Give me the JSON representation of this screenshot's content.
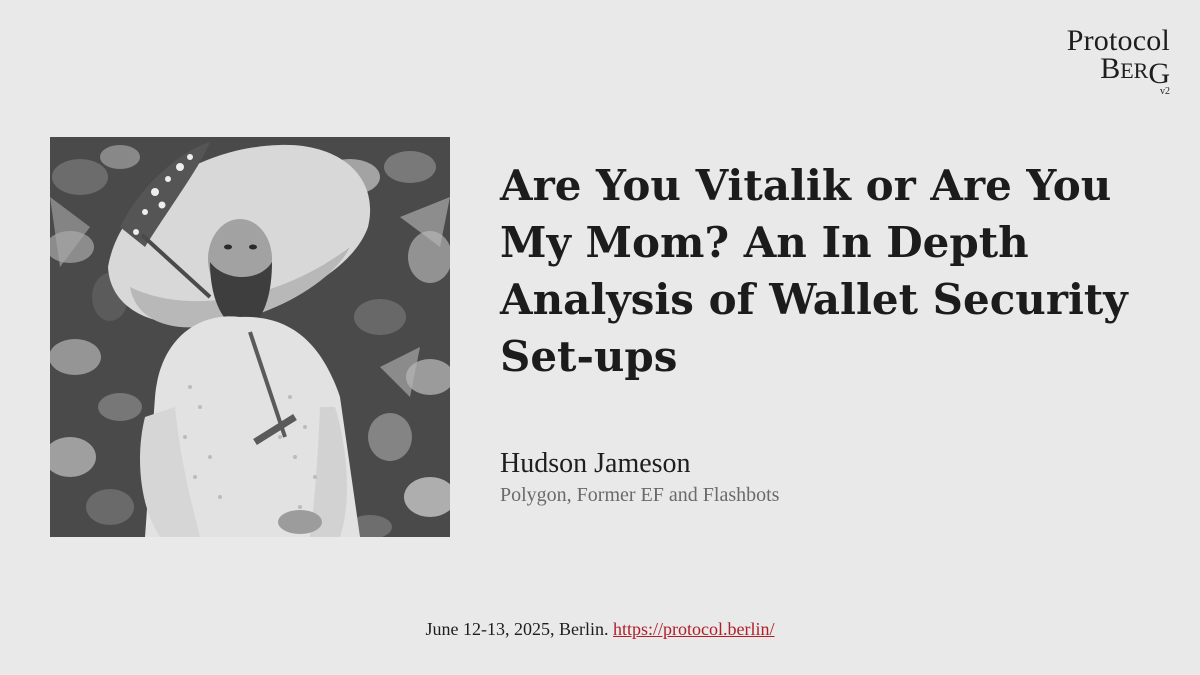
{
  "logo": {
    "line1": "Protocol",
    "line2_B": "B",
    "line2_ER": "ER",
    "line2_G": "G",
    "version": "v2"
  },
  "talk": {
    "title": "Are You Vitalik or Are You My Mom? An In Depth Analysis of Wallet Security Set-ups",
    "speaker": "Hudson Jameson",
    "affiliation": "Polygon, Former EF and Flashbots"
  },
  "footer": {
    "date_place": "June 12-13, 2025, Berlin.",
    "link_text": "https://protocol.berlin/",
    "link_color": "#b01e2a"
  },
  "photo": {
    "description_icon": "speaker-photo-grayscale"
  },
  "colors": {
    "background": "#e9e9e9",
    "title_text": "#1c1c1c",
    "affiliation_text": "#6a6a6a"
  }
}
